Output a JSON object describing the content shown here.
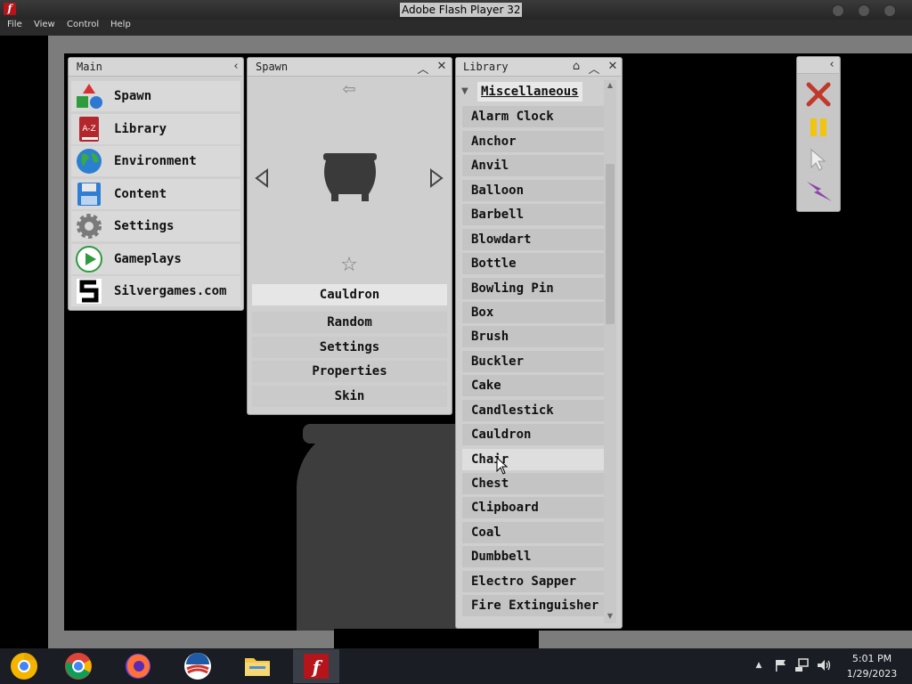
{
  "window": {
    "title": "Adobe Flash Player 32"
  },
  "menu": [
    "File",
    "View",
    "Control",
    "Help"
  ],
  "main_panel": {
    "title": "Main",
    "items": [
      {
        "label": "Spawn",
        "icon": "spawn-shapes-icon"
      },
      {
        "label": "Library",
        "icon": "library-book-icon"
      },
      {
        "label": "Environment",
        "icon": "globe-icon"
      },
      {
        "label": "Content",
        "icon": "floppy-disk-icon"
      },
      {
        "label": "Settings",
        "icon": "gear-icon"
      },
      {
        "label": "Gameplays",
        "icon": "play-icon"
      },
      {
        "label": "Silvergames.com",
        "icon": "silvergames-logo-icon"
      }
    ]
  },
  "spawn_panel": {
    "title": "Spawn",
    "selected": "Cauldron",
    "buttons": [
      "Random",
      "Settings",
      "Properties",
      "Skin"
    ]
  },
  "library_panel": {
    "title": "Library",
    "category": "Miscellaneous",
    "items": [
      "Alarm Clock",
      "Anchor",
      "Anvil",
      "Balloon",
      "Barbell",
      "Blowdart",
      "Bottle",
      "Bowling Pin",
      "Box",
      "Brush",
      "Buckler",
      "Cake",
      "Candlestick",
      "Cauldron",
      "Chair",
      "Chest",
      "Clipboard",
      "Coal",
      "Dumbbell",
      "Electro Sapper",
      "Fire Extinguisher"
    ],
    "hovered": "Chair"
  },
  "toolbar": {
    "tools": [
      "close-x-icon",
      "pause-icon",
      "pointer-icon",
      "lightning-icon"
    ]
  },
  "taskbar": {
    "apps": [
      "chrome-canary-icon",
      "chrome-icon",
      "firefox-icon",
      "obama-logo-icon",
      "file-explorer-icon",
      "flash-player-icon"
    ],
    "time": "5:01 PM",
    "date": "1/29/2023"
  },
  "colors": {
    "accent_red": "#c0392b",
    "pause_yellow": "#f1c40f",
    "lightning_purple": "#8e44ad"
  }
}
